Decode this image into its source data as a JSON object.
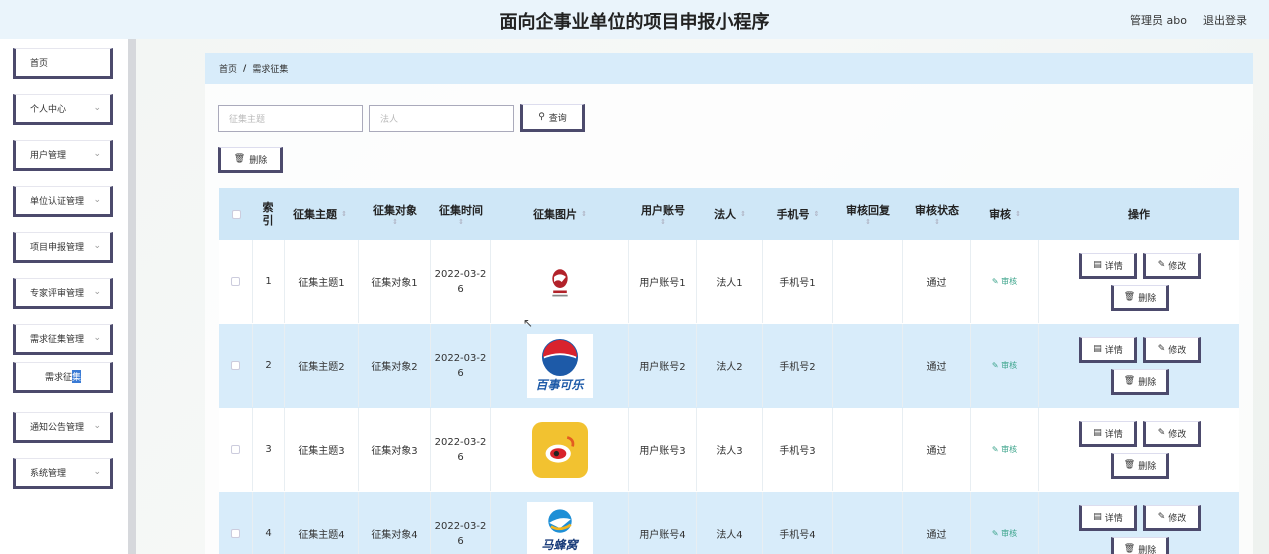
{
  "header": {
    "title": "面向企事业单位的项目申报小程序",
    "user": "管理员 abo",
    "logout": "退出登录"
  },
  "sidebar": {
    "items": [
      {
        "label": "首页",
        "expandable": false
      },
      {
        "label": "个人中心",
        "expandable": true
      },
      {
        "label": "用户管理",
        "expandable": true
      },
      {
        "label": "单位认证管理",
        "expandable": true
      },
      {
        "label": "项目申报管理",
        "expandable": true
      },
      {
        "label": "专家评审管理",
        "expandable": true
      },
      {
        "label": "需求征集管理",
        "expandable": true
      },
      {
        "label": "通知公告管理",
        "expandable": true
      },
      {
        "label": "系统管理",
        "expandable": true
      }
    ],
    "subitem": {
      "label_a": "需求征",
      "label_b": "集"
    }
  },
  "breadcrumb": {
    "home": "首页",
    "sep": "/",
    "current": "需求征集"
  },
  "search": {
    "subject_placeholder": "征集主题",
    "legal_placeholder": "法人",
    "query_label": "查询"
  },
  "toolbar": {
    "delete_label": "删除"
  },
  "table": {
    "headers": {
      "index_a": "索",
      "index_b": "引",
      "subject": "征集主题",
      "target": "征集对象",
      "time": "征集时间",
      "image": "征集图片",
      "account": "用户账号",
      "legal": "法人",
      "phone": "手机号",
      "reply": "审核回复",
      "status": "审核状态",
      "audit": "审核",
      "ops": "操作"
    },
    "rows": [
      {
        "index": "1",
        "subject": "征集主题1",
        "target": "征集对象1",
        "time_a": "2022-03-2",
        "time_b": "6",
        "account": "用户账号1",
        "legal": "法人1",
        "phone": "手机号1",
        "reply": "",
        "status": "通过",
        "audit": "审核"
      },
      {
        "index": "2",
        "subject": "征集主题2",
        "target": "征集对象2",
        "time_a": "2022-03-2",
        "time_b": "6",
        "account": "用户账号2",
        "legal": "法人2",
        "phone": "手机号2",
        "reply": "",
        "status": "通过",
        "audit": "审核"
      },
      {
        "index": "3",
        "subject": "征集主题3",
        "target": "征集对象3",
        "time_a": "2022-03-2",
        "time_b": "6",
        "account": "用户账号3",
        "legal": "法人3",
        "phone": "手机号3",
        "reply": "",
        "status": "通过",
        "audit": "审核"
      },
      {
        "index": "4",
        "subject": "征集主题4",
        "target": "征集对象4",
        "time_a": "2022-03-2",
        "time_b": "6",
        "account": "用户账号4",
        "legal": "法人4",
        "phone": "手机号4",
        "reply": "",
        "status": "通过",
        "audit": "审核"
      }
    ],
    "ops": {
      "detail": "详情",
      "edit": "修改",
      "delete": "删除"
    }
  },
  "logos": {
    "pepsi_text": "百事可乐",
    "plane_text": "马蜂窝"
  },
  "colors": {
    "accent": "#4c4a6c",
    "header_bg": "#eaf4fb",
    "row_alt": "#d8ecfa",
    "audit_link": "#3aa38a"
  }
}
